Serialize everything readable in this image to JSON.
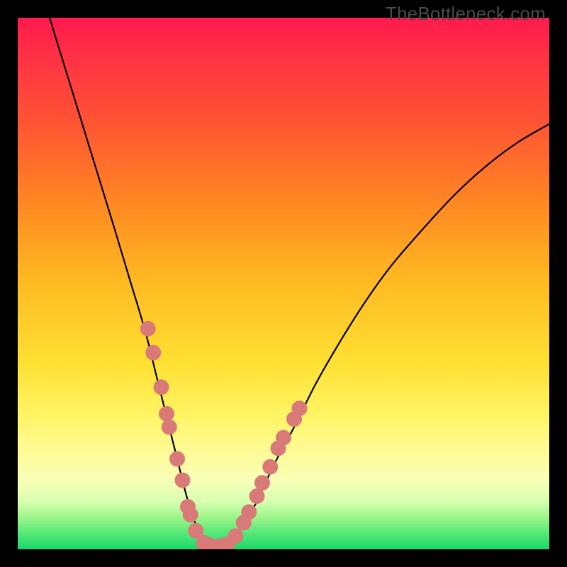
{
  "watermark": "TheBottleneck.com",
  "chart_data": {
    "type": "line",
    "title": "",
    "xlabel": "",
    "ylabel": "",
    "xlim": [
      0,
      100
    ],
    "ylim": [
      0,
      100
    ],
    "grid": false,
    "series": [
      {
        "name": "bottleneck-curve",
        "color": "#000000",
        "x": [
          6,
          10,
          14,
          18,
          21,
          24,
          26,
          28,
          30,
          31.5,
          33,
          34.5,
          36,
          38,
          40,
          42,
          45,
          48,
          52,
          56,
          60,
          65,
          70,
          76,
          82,
          88,
          94,
          100
        ],
        "values": [
          100,
          87,
          74,
          61,
          51,
          41,
          33,
          25,
          17,
          11,
          6,
          2.5,
          0.8,
          0.5,
          1.3,
          4,
          9,
          15.5,
          23,
          31,
          38,
          46,
          53,
          60,
          66.5,
          72,
          76.5,
          80
        ]
      }
    ],
    "markers": {
      "name": "highlight-dots",
      "color": "#d97a78",
      "radius_px": 11,
      "points_xy": [
        [
          24.5,
          41.5
        ],
        [
          25.5,
          37
        ],
        [
          27,
          30.5
        ],
        [
          28,
          25.5
        ],
        [
          28.5,
          23
        ],
        [
          30,
          17
        ],
        [
          31,
          13
        ],
        [
          32,
          8
        ],
        [
          32.5,
          6.5
        ],
        [
          33.5,
          3.5
        ],
        [
          35,
          1.2
        ],
        [
          36,
          0.8
        ],
        [
          38,
          0.6
        ],
        [
          39.5,
          1.0
        ],
        [
          41,
          2.5
        ],
        [
          42.5,
          5
        ],
        [
          43.5,
          7
        ],
        [
          45,
          10
        ],
        [
          46,
          12.5
        ],
        [
          47.5,
          15.5
        ],
        [
          49,
          19
        ],
        [
          50,
          21
        ],
        [
          52,
          24.5
        ],
        [
          53,
          26.5
        ]
      ]
    },
    "background_gradient": {
      "top": "#ff1a4d",
      "mid1": "#ffbb22",
      "mid2": "#fff566",
      "bottom": "#18d968"
    }
  }
}
